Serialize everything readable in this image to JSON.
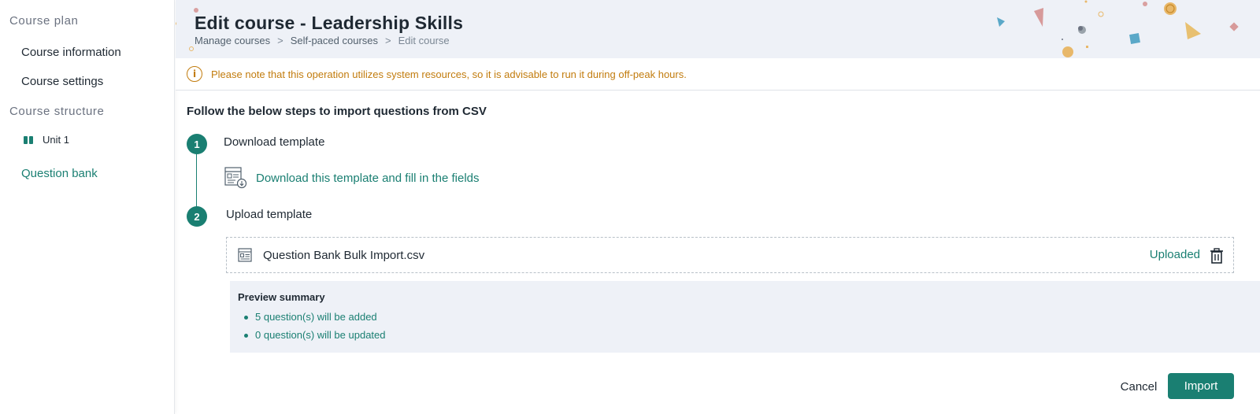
{
  "sidebar": {
    "course_plan_heading": "Course plan",
    "course_information": "Course information",
    "course_settings": "Course settings",
    "course_structure_heading": "Course structure",
    "unit_label": "Unit 1",
    "question_bank": "Question bank"
  },
  "header": {
    "title": "Edit course - Leadership Skills",
    "breadcrumb": [
      "Manage courses",
      "Self-paced courses",
      "Edit course"
    ],
    "breadcrumb_separator": ">"
  },
  "notice": {
    "icon": "info-icon",
    "text": "Please note that this operation utilizes system resources, so it is advisable to run it during off-peak hours."
  },
  "main": {
    "steps_title": "Follow the below steps to import questions from CSV",
    "steps": [
      {
        "number": "1",
        "label": "Download template"
      },
      {
        "number": "2",
        "label": "Upload template"
      }
    ],
    "download_link": "Download this template and fill in the fields",
    "file": {
      "name": "Question Bank Bulk Import.csv",
      "status": "Uploaded"
    },
    "preview": {
      "title": "Preview summary",
      "items": [
        "5 question(s) will be added",
        "0 question(s) will be updated"
      ]
    }
  },
  "actions": {
    "cancel": "Cancel",
    "import": "Import"
  },
  "colors": {
    "accent": "#1a7f72",
    "warning": "#c27c0e",
    "header_bg": "#eef1f7"
  }
}
